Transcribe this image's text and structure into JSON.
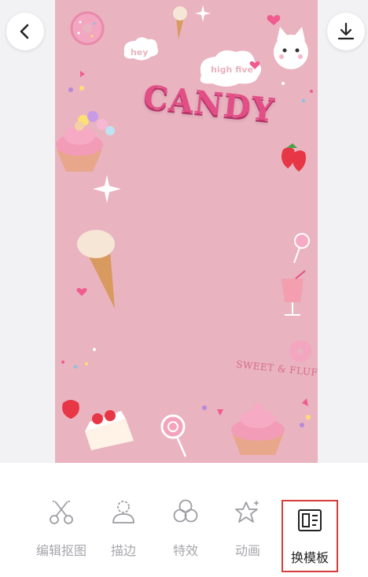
{
  "poster": {
    "title": "CANDY",
    "bubble_small": "hey",
    "bubble_large": "high five",
    "sweet_text": "SWEET & FLUFFY"
  },
  "icons": {
    "back": "chevron-left-icon",
    "download": "download-icon"
  },
  "toolbar": {
    "items": [
      {
        "label": "编辑抠图",
        "icon": "scissors-icon",
        "active": false
      },
      {
        "label": "描边",
        "icon": "person-outline-icon",
        "active": false
      },
      {
        "label": "特效",
        "icon": "circles-icon",
        "active": false
      },
      {
        "label": "动画",
        "icon": "star-icon",
        "active": false
      },
      {
        "label": "换模板",
        "icon": "template-icon",
        "active": true
      }
    ]
  },
  "colors": {
    "poster_bg": "#e9b3c0",
    "accent": "#d63d3d",
    "candy_pink": "#e24f86",
    "inactive_label": "#a7a7ad"
  }
}
